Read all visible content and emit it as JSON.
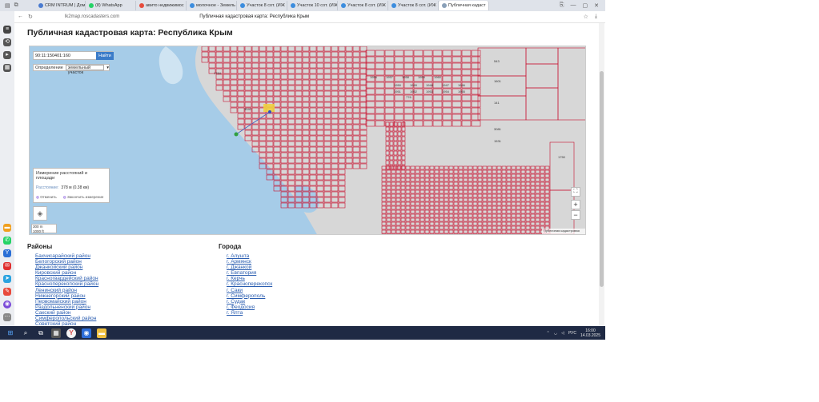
{
  "browser": {
    "tabs": [
      {
        "label": "CRM INTRUM | Дом",
        "color": "#4a7bd0"
      },
      {
        "label": "(8) WhatsApp",
        "color": "#25d366"
      },
      {
        "label": "авито недвижимос",
        "color": "#e74c3c"
      },
      {
        "label": "молочное - Земель",
        "color": "#3c8dde"
      },
      {
        "label": "Участок 8 сот. (ИЖ",
        "color": "#3c8dde"
      },
      {
        "label": "Участок 10 сот. (ИЖ",
        "color": "#3c8dde"
      },
      {
        "label": "Участок 8 сот. (ИЖ",
        "color": "#3c8dde"
      },
      {
        "label": "Участок 8 сот. (ИЖ",
        "color": "#3c8dde"
      },
      {
        "label": "Публичная кадаст",
        "color": "#8aa0b8"
      }
    ],
    "url": "lk2map.roscadasters.com",
    "title": "Публичная кадастровая карта: Республика Крым"
  },
  "page": {
    "title": "Публичная кадастровая карта: Республика Крым"
  },
  "map": {
    "search_value": "90:11:150401:160",
    "search_button": "Найти",
    "type_label": "Определение",
    "type_value": "земельный участок",
    "measure": {
      "title": "Измерение расстояний и площади",
      "distance_label": "Расстояние:",
      "distance_value": "378 м (0.38 км)",
      "cancel": "Отменить",
      "finish": "Закончить измерение"
    },
    "scale": [
      "300 m",
      "1000 ft"
    ],
    "zoom_in": "+",
    "zoom_out": "−",
    "fullscreen": "⛶",
    "copyright": "Публичная кадастровая карта",
    "parcel_labels": [
      "1764",
      "3540",
      "776",
      "1950",
      "1949",
      "1948",
      "1947",
      "1946",
      "1951",
      "1952",
      "1953",
      "1954",
      "1955",
      "1956",
      "1957",
      "1958",
      "1959",
      "1960",
      "543",
      "1601",
      "141",
      "3081",
      "1531",
      "1750"
    ]
  },
  "districts": {
    "heading": "Районы",
    "items": [
      "Бахчисарайский район",
      "Белогорский район",
      "Джанкойский район",
      "Кировский район",
      "Красногвардейский район",
      "Красноперекопский район",
      "Ленинский район",
      "Нижнегорский район",
      "Первомайский район",
      "Раздольненский район",
      "Сакский район",
      "Симферопольский район",
      "Советский район"
    ]
  },
  "cities": {
    "heading": "Города",
    "items": [
      "г. Алушта",
      "г. Армянск",
      "г. Джанкой",
      "г. Евпатория",
      "г. Керчь",
      "г. Красноперекопск",
      "г. Саки",
      "г. Симферополь",
      "г. Судак",
      "г. Феодосия",
      "г. Ялта"
    ]
  },
  "taskbar": {
    "lang": "РУС",
    "time": "16:00",
    "date": "14.03.2025"
  }
}
